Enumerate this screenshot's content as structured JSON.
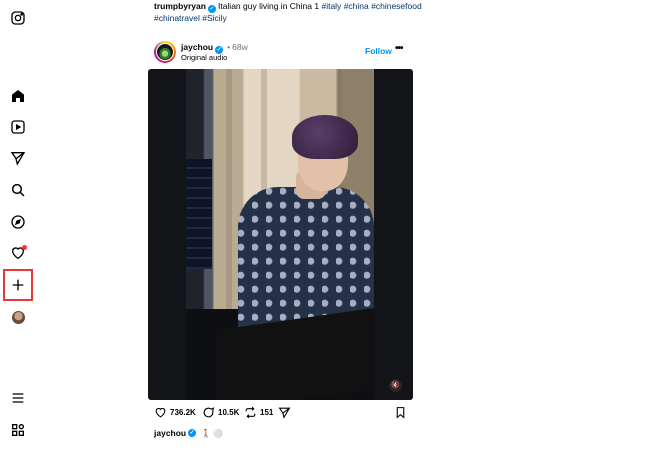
{
  "nav": {
    "items": [
      {
        "name": "instagram-logo-icon"
      },
      {
        "name": "home-icon"
      },
      {
        "name": "reels-icon"
      },
      {
        "name": "messages-icon"
      },
      {
        "name": "search-icon"
      },
      {
        "name": "explore-icon"
      },
      {
        "name": "notifications-icon"
      },
      {
        "name": "create-icon"
      },
      {
        "name": "profile-avatar"
      },
      {
        "name": "menu-icon"
      },
      {
        "name": "more-apps-icon"
      }
    ]
  },
  "caption": {
    "username": "trumpbyryan",
    "text": "Italian guy living in China 1",
    "tags": [
      "#italy",
      "#china",
      "#chinesefood",
      "#chinatravel",
      "#Sicily"
    ]
  },
  "post": {
    "username": "jaychou",
    "time": "68w",
    "audio": "Original audio",
    "follow_label": "Follow",
    "more_label": "•••"
  },
  "actions": {
    "likes": "736.2K",
    "comments": "10.5K",
    "reposts": "151"
  },
  "footer": {
    "username": "jaychou",
    "emoji": "🚶 ⚪"
  },
  "colors": {
    "accent": "#0095f6",
    "highlight_box": "#e53935",
    "hashtag": "#00376b"
  }
}
